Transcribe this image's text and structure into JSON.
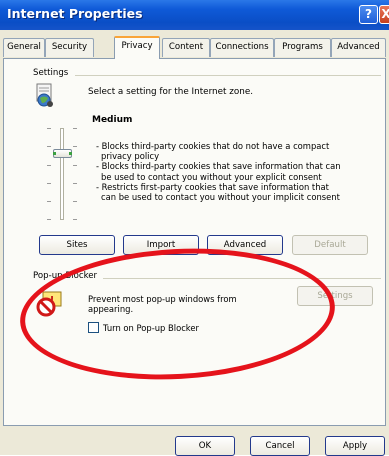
{
  "window": {
    "title": "Internet Properties",
    "help_glyph": "?",
    "close_glyph": "X",
    "colors": {
      "titlebar": "#0a4ec6",
      "face": "#ece9d8",
      "annotation": "#e5131b"
    }
  },
  "tabs": [
    {
      "label": "General"
    },
    {
      "label": "Security"
    },
    {
      "label": "Privacy",
      "selected": true
    },
    {
      "label": "Content"
    },
    {
      "label": "Connections"
    },
    {
      "label": "Programs"
    },
    {
      "label": "Advanced"
    }
  ],
  "settings": {
    "group_label": "Settings",
    "prompt": "Select a setting for the Internet zone.",
    "level": "Medium",
    "description_lines": [
      "- Blocks third-party cookies that do not have a compact",
      "privacy policy",
      "- Blocks third-party cookies that save information that can",
      "be used to contact you without your explicit consent",
      "- Restricts first-party cookies that save information that",
      "can be used to contact you without your implicit consent"
    ],
    "buttons": {
      "sites": "Sites",
      "import": "Import",
      "advanced": "Advanced",
      "default": "Default"
    }
  },
  "popup": {
    "group_label": "Pop-up Blocker",
    "message_line1": "Prevent most pop-up windows from",
    "message_line2": "appearing.",
    "settings_label": "Settings",
    "checkbox_label": "Turn on Pop-up Blocker",
    "checkbox_checked": false
  },
  "footer": {
    "ok": "OK",
    "cancel": "Cancel",
    "apply": "Apply"
  }
}
